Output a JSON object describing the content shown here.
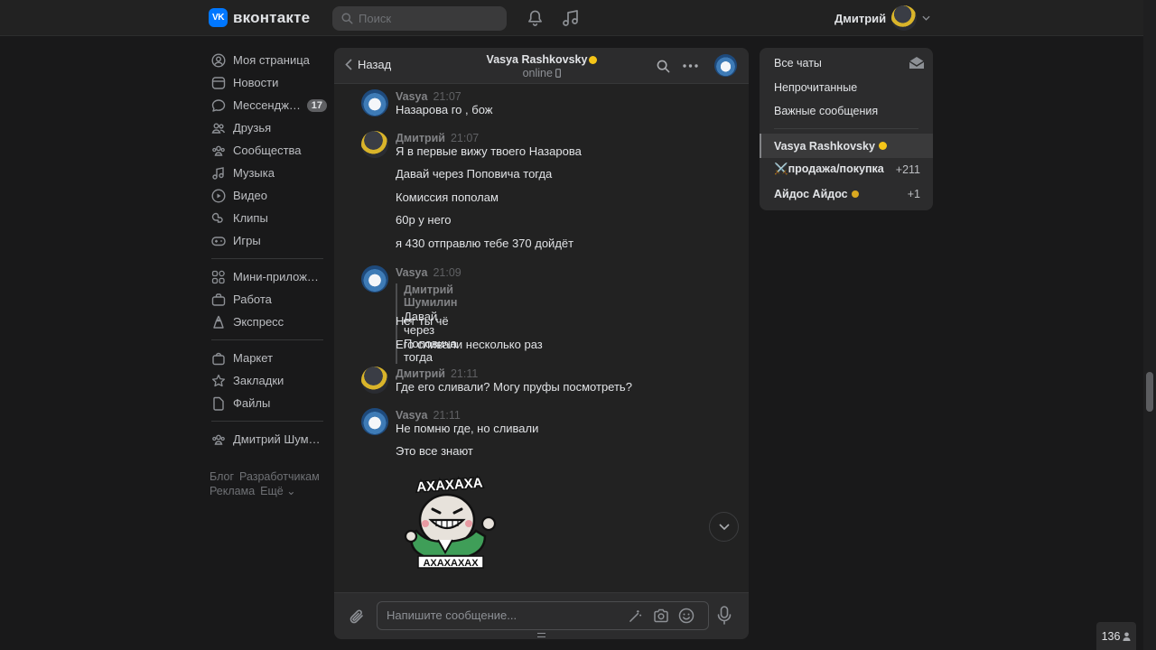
{
  "header": {
    "logo_mark": "VK",
    "logo_text": "вконтакте",
    "search_placeholder": "Поиск",
    "user_name": "Дмитрий"
  },
  "nav": {
    "items": [
      {
        "label": "Моя страница",
        "icon": "user-circle-icon"
      },
      {
        "label": "Новости",
        "icon": "newspaper-icon"
      },
      {
        "label": "Мессенджер",
        "icon": "chat-bubble-icon",
        "badge": "17"
      },
      {
        "label": "Друзья",
        "icon": "friends-icon"
      },
      {
        "label": "Сообщества",
        "icon": "communities-icon"
      },
      {
        "label": "Музыка",
        "icon": "music-icon"
      },
      {
        "label": "Видео",
        "icon": "video-play-icon"
      },
      {
        "label": "Клипы",
        "icon": "clips-icon"
      },
      {
        "label": "Игры",
        "icon": "gamepad-icon"
      },
      {
        "label": "Мини-приложения",
        "icon": "grid-apps-icon"
      },
      {
        "label": "Работа",
        "icon": "briefcase-icon"
      },
      {
        "label": "Экспресс",
        "icon": "express-icon"
      },
      {
        "label": "Маркет",
        "icon": "bag-icon"
      },
      {
        "label": "Закладки",
        "icon": "star-icon"
      },
      {
        "label": "Файлы",
        "icon": "file-icon"
      },
      {
        "label": "Дмитрий Шумилин",
        "icon": "group-icon"
      }
    ],
    "footer": {
      "blog": "Блог",
      "developers": "Разработчикам",
      "ads": "Реклама",
      "more": "Ещё ⌄"
    }
  },
  "chat": {
    "back_label": "Назад",
    "peer_name": "Vasya Rashkovsky",
    "peer_status": "online",
    "groups": [
      {
        "author": "Vasya",
        "time": "21:07",
        "messages": [
          "Назарова го , бож"
        ]
      },
      {
        "author": "Дмитрий",
        "time": "21:07",
        "messages": [
          "Я в первые вижу твоего Назарова",
          "Давай через Поповича тогда",
          "Комиссия пополам",
          "60р у него",
          "я 430 отправлю тебе 370 дойдёт"
        ]
      },
      {
        "author": "Vasya",
        "time": "21:09",
        "reply": {
          "author": "Дмитрий Шумилин",
          "text": "Давай через Поповича тогда"
        },
        "messages": [
          "Нет ты чё",
          "Его сливали несколько раз"
        ]
      },
      {
        "author": "Дмитрий",
        "time": "21:11",
        "messages": [
          "Где его сливали? Могу пруфы посмотреть?"
        ]
      },
      {
        "author": "Vasya",
        "time": "21:11",
        "messages": [
          "Не помню где, но сливали",
          "Это все знают"
        ]
      }
    ],
    "sticker": {
      "top_text": "АХАХАХА",
      "bottom_text": "АХАХАХАХ"
    },
    "composer_placeholder": "Напишите сообщение..."
  },
  "right_panel": {
    "filters": [
      "Все чаты",
      "Непрочитанные",
      "Важные сообщения"
    ],
    "conversations": [
      {
        "name": "Vasya Rashkovsky",
        "count": "",
        "active": true
      },
      {
        "name": "⚔️продажа/покупка",
        "count": "+211",
        "active": false
      },
      {
        "name": "Айдос Айдос",
        "count": "+1",
        "active": false
      }
    ]
  },
  "online_counter": "136",
  "colors": {
    "background": "#19191a",
    "panel": "#222222",
    "header": "#2c2c2d",
    "accent": "#0077ff",
    "text": "#e1e3e6",
    "muted": "#828386"
  }
}
